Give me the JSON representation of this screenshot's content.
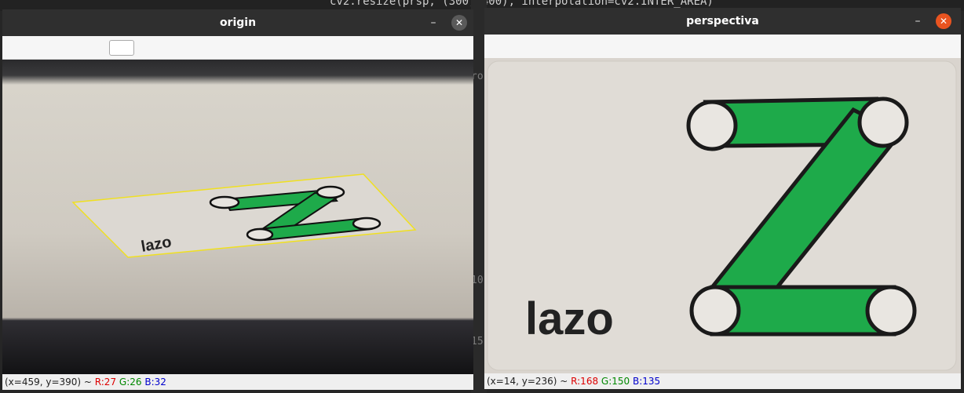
{
  "background": {
    "code_line": "cv2.resize(prsp, (300, 400), interpolation=cv2.INTER_AREA)",
    "gutter_numbers": [
      "ro",
      "10",
      "15"
    ]
  },
  "windows": {
    "origin": {
      "title": "origin",
      "minimize_label": "–",
      "close_label": "✕",
      "status": {
        "coords": "(x=459, y=390) ~ ",
        "r": "R:27",
        "g": "G:26",
        "b": "B:32"
      },
      "card_text": "lazo"
    },
    "perspectiva": {
      "title": "perspectiva",
      "minimize_label": "–",
      "close_label": "✕",
      "status": {
        "coords": "(x=14, y=236) ~ ",
        "r": "R:168",
        "g": "G:150",
        "b": "B:135"
      },
      "card_text": "lazo"
    }
  },
  "colors": {
    "close_origin": "#5a5a5a",
    "close_perspectiva": "#e95420",
    "logo_green": "#1eaa4a",
    "outline_yellow": "#f0e020"
  }
}
